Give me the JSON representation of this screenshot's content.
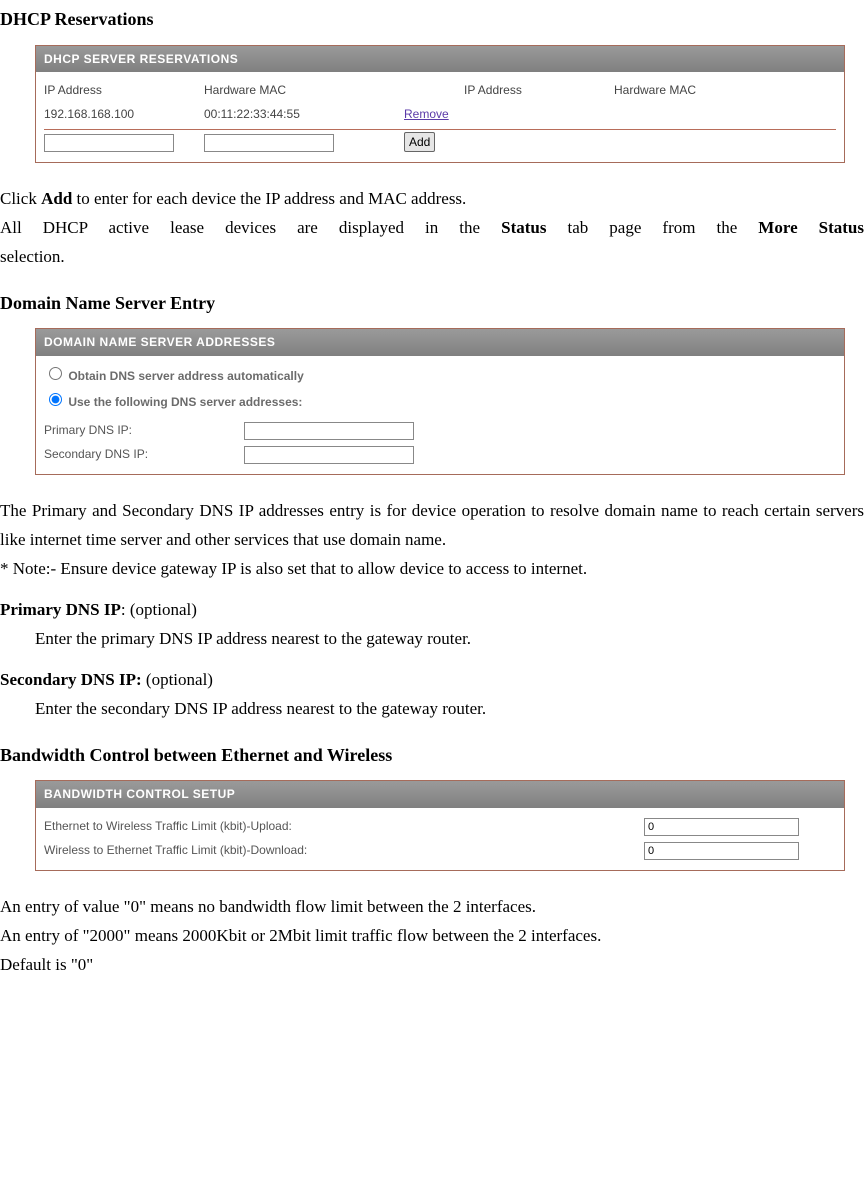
{
  "headings": {
    "dhcp_reservations": "DHCP Reservations",
    "dns_entry": "Domain Name Server Entry",
    "bandwidth_control": "Bandwidth Control between Ethernet and Wireless"
  },
  "dhcp_panel": {
    "title": "DHCP SERVER RESERVATIONS",
    "cols": {
      "ip": "IP Address",
      "mac": "Hardware MAC",
      "ip2": "IP Address",
      "mac2": "Hardware MAC"
    },
    "row": {
      "ip": "192.168.168.100",
      "mac": "00:11:22:33:44:55",
      "remove": "Remove"
    },
    "add_label": "Add"
  },
  "dhcp_text": {
    "p1a": "Click ",
    "p1b": "Add",
    "p1c": " to enter for each device the IP address and MAC address.",
    "p2a": "All DHCP active lease devices are displayed in the ",
    "p2b": "Status",
    "p2c": " tab page from the ",
    "p2d": "More Status",
    "p2e": " ",
    "p3": "selection."
  },
  "dns_panel": {
    "title": "DOMAIN NAME SERVER ADDRESSES",
    "opt_auto": "Obtain DNS server address automatically",
    "opt_manual": "Use the following DNS server addresses:",
    "primary_label": "Primary DNS IP:",
    "secondary_label": "Secondary DNS IP:"
  },
  "dns_text": {
    "p1": "The Primary and Secondary DNS IP addresses entry is for device operation to resolve domain name to reach certain servers like internet time server and other services that use domain name.",
    "p2": "* Note:- Ensure device gateway IP is also set that to allow device to access to internet.",
    "primary_h_b": "Primary DNS IP",
    "primary_h_t": ": (optional)",
    "primary_body": "Enter the primary DNS IP address nearest to the gateway router.",
    "secondary_h_b": "Secondary DNS IP:",
    "secondary_h_t": " (optional)",
    "secondary_body": "Enter the secondary DNS IP address nearest to the gateway router."
  },
  "bw_panel": {
    "title": "BANDWIDTH CONTROL SETUP",
    "upload_label": "Ethernet to Wireless Traffic Limit (kbit)-Upload:",
    "download_label": "Wireless to Ethernet Traffic Limit (kbit)-Download:",
    "upload_value": "0",
    "download_value": "0"
  },
  "bw_text": {
    "p1": "An entry of value \"0\" means no bandwidth flow limit between the 2 interfaces.",
    "p2": "An entry of \"2000\" means 2000Kbit or 2Mbit limit traffic flow between the 2 interfaces.",
    "p3": "Default is \"0\""
  }
}
